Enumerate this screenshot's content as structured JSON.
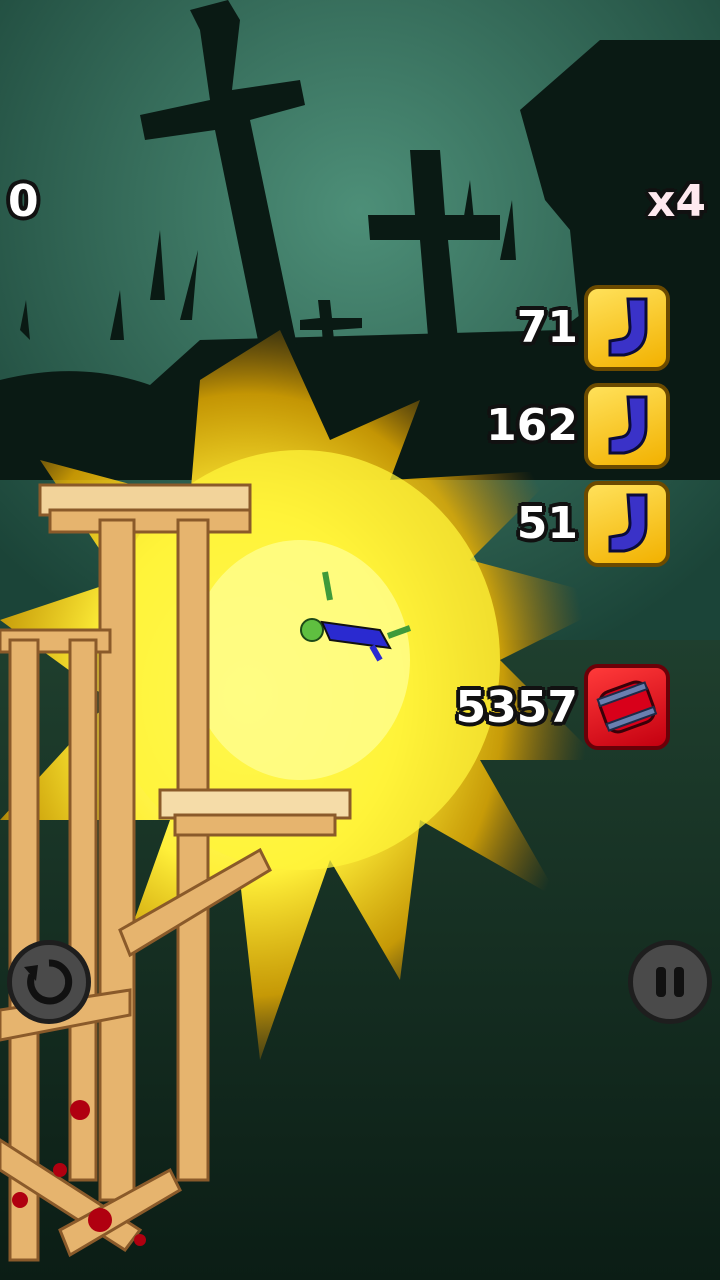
{
  "hud": {
    "score": "0",
    "multiplier": "x4"
  },
  "inventory": [
    {
      "count": "71",
      "icon": "boot-icon"
    },
    {
      "count": "162",
      "icon": "boot-icon"
    },
    {
      "count": "51",
      "icon": "boot-icon"
    }
  ],
  "barrel": {
    "count": "5357",
    "icon": "barrel-icon"
  },
  "controls": {
    "restart_icon": "restart-icon",
    "pause_icon": "pause-icon"
  },
  "colors": {
    "sky": "#2f6b58",
    "explosion": "#ffe93a",
    "boot_tile": "#f5c400",
    "barrel_tile": "#e3001b"
  }
}
